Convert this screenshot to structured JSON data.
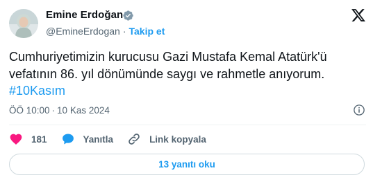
{
  "user": {
    "name": "Emine Erdoğan",
    "handle": "@EmineErdogan",
    "follow_label": "Takip et",
    "separator": "·"
  },
  "tweet": {
    "text": "Cumhuriyetimizin kurucusu Gazi Mustafa Kemal Atatürk'ü vefatının 86. yıl dönümünde saygı ve rahmetle anıyorum.",
    "hashtag": "#10Kasım"
  },
  "meta": {
    "time": "ÖÖ 10:00",
    "separator": "·",
    "date": "10 Kas 2024"
  },
  "actions": {
    "like_count": "181",
    "reply_label": "Yanıtla",
    "copy_link_label": "Link kopyala"
  },
  "replies_button": {
    "label": "13 yanıtı oku"
  },
  "colors": {
    "accent": "#1d9bf0",
    "like": "#f91880",
    "text": "#0f1419",
    "secondary": "#536471",
    "verified_badge": "#829aab"
  },
  "icons": {
    "verified": "verified-badge-icon",
    "x_logo": "x-logo-icon",
    "info": "info-icon",
    "like": "heart-icon",
    "reply": "speech-bubble-icon",
    "link": "link-icon"
  }
}
